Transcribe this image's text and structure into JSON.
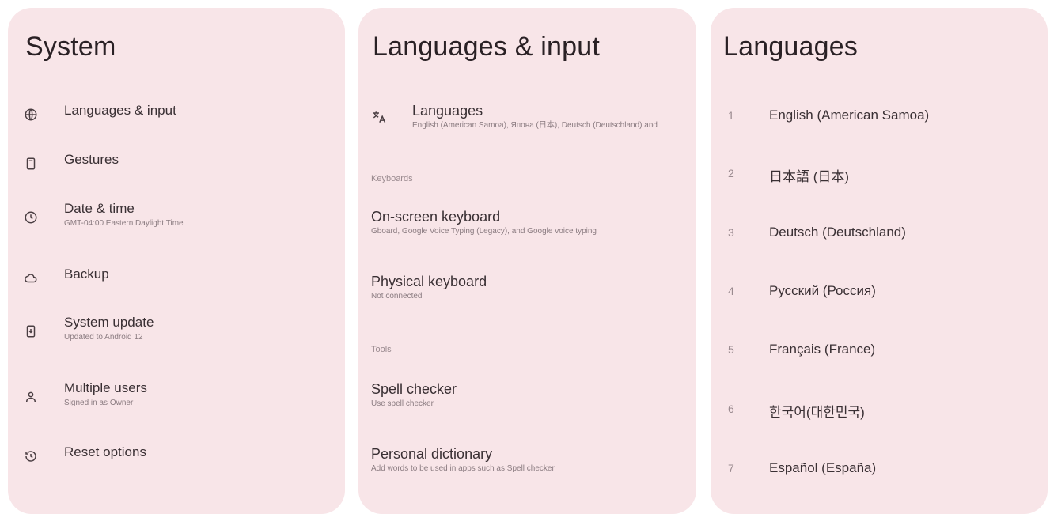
{
  "system": {
    "title": "System",
    "items": [
      {
        "label": "Languages & input",
        "sub": "",
        "icon": "globe-icon"
      },
      {
        "label": "Gestures",
        "sub": "",
        "icon": "phone-icon"
      },
      {
        "label": "Date & time",
        "sub": "GMT-04:00 Eastern Daylight Time",
        "icon": "clock-icon"
      },
      {
        "label": "Backup",
        "sub": "",
        "icon": "cloud-icon"
      },
      {
        "label": "System update",
        "sub": "Updated to Android 12",
        "icon": "system-update-icon"
      },
      {
        "label": "Multiple users",
        "sub": "Signed in as Owner",
        "icon": "users-icon"
      },
      {
        "label": "Reset options",
        "sub": "",
        "icon": "history-icon"
      }
    ]
  },
  "languages_input": {
    "title": "Languages & input",
    "languages_label": "Languages",
    "languages_sub": "English (American Samoa), Япона (日本), Deutsch (Deutschland) and",
    "section_keyboards": "Keyboards",
    "onscreen_label": "On-screen keyboard",
    "onscreen_sub": "Gboard, Google Voice Typing (Legacy), and Google voice typing",
    "physical_label": "Physical keyboard",
    "physical_sub": "Not connected",
    "section_tools": "Tools",
    "spell_label": "Spell checker",
    "spell_sub": "Use spell checker",
    "dictionary_label": "Personal dictionary",
    "dictionary_sub": "Add words to be used in apps such as Spell checker"
  },
  "languages": {
    "title": "Languages",
    "items": [
      {
        "num": "1",
        "name": "English (American Samoa)"
      },
      {
        "num": "2",
        "name": "日本語 (日本)"
      },
      {
        "num": "3",
        "name": "Deutsch (Deutschland)"
      },
      {
        "num": "4",
        "name": "Русский (Россия)"
      },
      {
        "num": "5",
        "name": "Français (France)"
      },
      {
        "num": "6",
        "name": "한국어(대한민국)"
      },
      {
        "num": "7",
        "name": "Español (España)"
      }
    ]
  }
}
